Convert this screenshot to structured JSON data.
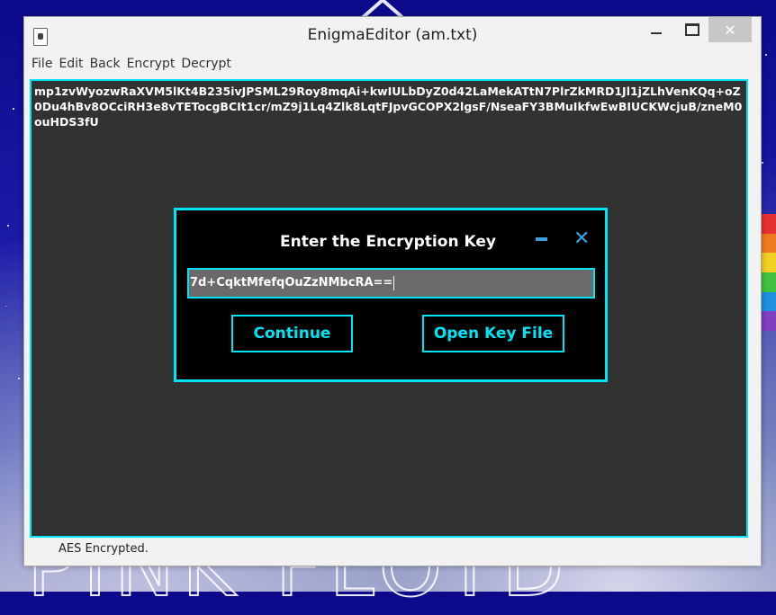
{
  "window": {
    "title": "EnigmaEditor (am.txt)",
    "close_glyph": "✕"
  },
  "menu": {
    "items": [
      "File",
      "Edit",
      "Back",
      "Encrypt",
      "Decrypt"
    ]
  },
  "editor": {
    "content": "mp1zvWyozwRaXVM5lKt4B235ivJPSML29Roy8mqAi+kwIULbDyZ0d42LaMekATtN7PlrZkMRD1Jl1jZLhVenKQq+oZ0Du4hBv8OCciRH3e8vTETocgBCIt1cr/mZ9j1Lq4Zlk8LqtFJpvGCOPX2lgsF/NseaFY3BMuIkfwEwBIUCKWcjuB/zneM0ouHDS3fU"
  },
  "status": {
    "text": "AES Encrypted."
  },
  "dialog": {
    "title": "Enter the Encryption Key",
    "close_glyph": "✕",
    "key_value": "7d+CqktMfefqOuZzNMbcRA==",
    "continue_label": "Continue",
    "open_key_label": "Open Key File"
  },
  "colors": {
    "accent": "#00e5f5",
    "dialog_bg": "#000000",
    "editor_bg": "#323232",
    "dialog_icons": "#3aa0e0"
  }
}
